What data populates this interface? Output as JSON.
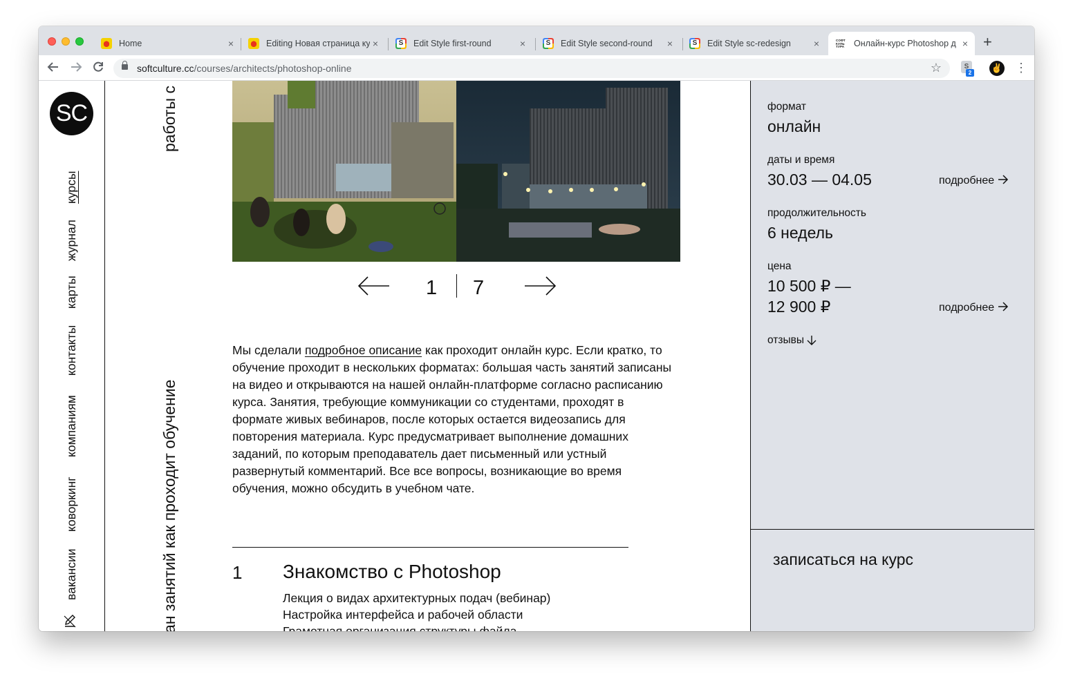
{
  "browser": {
    "tabs": [
      {
        "title": "Home",
        "favicon": "yandex-eats-icon"
      },
      {
        "title": "Editing Новая страница ку",
        "favicon": "yandex-eats-icon"
      },
      {
        "title": "Edit Style first-round",
        "favicon": "style-s-icon"
      },
      {
        "title": "Edit Style second-round",
        "favicon": "style-s-icon"
      },
      {
        "title": "Edit Style sc-redesign",
        "favicon": "style-s-icon"
      },
      {
        "title": "Онлайн-курс Photoshop д",
        "favicon": "softculture-icon",
        "active": true
      }
    ],
    "favicon_soft_text": "СОФТ КУЛЬ ТУРА",
    "close_glyph": "×",
    "new_tab_glyph": "+",
    "url_host": "softculture.cc",
    "url_path": "/courses/architects/photoshop-online",
    "extension_badge": "2",
    "extension_letter": "S"
  },
  "site": {
    "logo": "SC",
    "nav": [
      {
        "label": "курсы",
        "current": true
      },
      {
        "label": "журнал"
      },
      {
        "label": "карты"
      },
      {
        "label": "контакты"
      },
      {
        "label": "компаниям"
      },
      {
        "label": "коворкинг"
      },
      {
        "label": "вакансии"
      }
    ],
    "section_labels": {
      "top": "работы с",
      "bottom": "ан занятий  как проходит обучение"
    }
  },
  "gallery": {
    "current": "1",
    "total": "7"
  },
  "description": {
    "before_link": "Мы сделали ",
    "link": "подробное описание",
    "after_link": " как проходит онлайн курс. Если кратко, то обучение проходит в нескольких форматах: большая часть занятий записаны на видео и открываются на нашей онлайн-платформе согласно расписанию курса. Занятия, требующие коммуникации со студентами, проходят в формате живых вебинаров, после которых остается видеозапись для повторения материала. Курс предусматривает выполнение домашних заданий, по которым преподаватель дает письменный или устный развернутый комментарий. Все все вопросы, возникающие во время обучения, можно обсудить в учебном чате."
  },
  "lesson": {
    "number": "1",
    "title": "Знакомство с Photoshop",
    "items": [
      "Лекция о видах архитектурных подач (вебинар)",
      "Настройка интерфейса и рабочей области",
      "Грамотная организация структуры файла"
    ]
  },
  "sidebar": {
    "format_label": "формат",
    "format_value": "онлайн",
    "dates_label": "даты и время",
    "dates_value": "30.03 — 04.05",
    "duration_label": "продолжительность",
    "duration_value": "6 недель",
    "price_label": "цена",
    "price_line1": "10 500 ₽ —",
    "price_line2": "12 900 ₽",
    "more": "подробнее",
    "reviews": "отзывы",
    "cta": "записаться на курс"
  },
  "colors": {
    "sidebar_bg": "#dfe2e8",
    "text": "#111111",
    "tabstrip": "#dee1e6"
  }
}
